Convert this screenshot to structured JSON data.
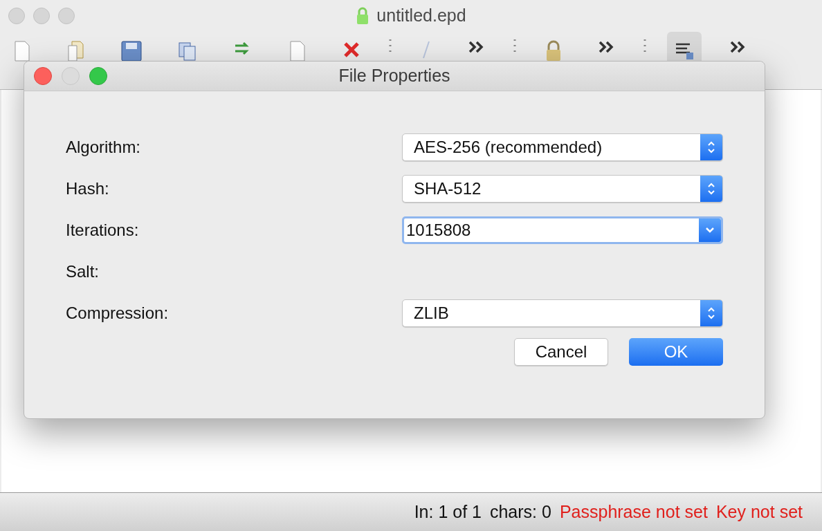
{
  "window": {
    "title": "untitled.epd"
  },
  "toolbar": [
    {
      "kind": "doc",
      "selected": false
    },
    {
      "kind": "folder",
      "selected": false
    },
    {
      "kind": "save",
      "selected": false
    },
    {
      "kind": "copy",
      "selected": false
    },
    {
      "kind": "arrows",
      "selected": false
    },
    {
      "kind": "doc",
      "selected": false
    },
    {
      "kind": "delete",
      "selected": false
    },
    {
      "kind": "sep"
    },
    {
      "kind": "pen",
      "selected": false
    },
    {
      "kind": "more",
      "selected": false
    },
    {
      "kind": "sep"
    },
    {
      "kind": "lock",
      "selected": false
    },
    {
      "kind": "more",
      "selected": false
    },
    {
      "kind": "sep"
    },
    {
      "kind": "lines",
      "selected": true
    },
    {
      "kind": "more",
      "selected": false
    }
  ],
  "dialog": {
    "title": "File Properties",
    "fields": [
      {
        "label": "Algorithm:",
        "kind": "select",
        "value": "AES-256 (recommended)"
      },
      {
        "label": "Hash:",
        "kind": "select",
        "value": "SHA-512"
      },
      {
        "label": "Iterations:",
        "kind": "combo",
        "value": "1015808"
      },
      {
        "label": "Salt:",
        "kind": "none"
      },
      {
        "label": "Compression:",
        "kind": "select",
        "value": "ZLIB"
      }
    ],
    "buttons": [
      {
        "label": "Cancel",
        "primary": false
      },
      {
        "label": "OK",
        "primary": true
      }
    ]
  },
  "status_bar": [
    {
      "text": "In: 1 of 1",
      "kind": "info"
    },
    {
      "text": "chars: 0",
      "kind": "info"
    },
    {
      "text": "Passphrase not set",
      "kind": "warning"
    },
    {
      "text": "Key not set",
      "kind": "warning"
    }
  ]
}
